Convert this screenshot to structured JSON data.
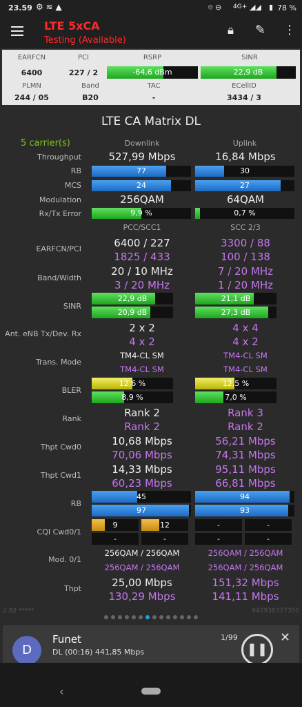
{
  "status": {
    "time": "23.59",
    "network": "4G+",
    "battery": "78 %"
  },
  "app": {
    "title": "LTE 5xCA",
    "subtitle": "Testing (Available)"
  },
  "hdr": {
    "l": {
      "earfcn": "EARFCN",
      "pci": "PCI",
      "rsrp": "RSRP",
      "sinr": "SINR",
      "plmn": "PLMN",
      "band": "Band",
      "tac": "TAC",
      "ecell": "ECellID"
    },
    "v": {
      "earfcn": "6400",
      "pci": "227 / 2",
      "rsrp": "-64,6 dBm",
      "sinr": "22,9 dB",
      "plmn": "244 / 05",
      "band": "B20",
      "tac": "-",
      "ecell": "3434 / 3"
    },
    "rsrp_fill": 0.62,
    "sinr_fill": 0.8
  },
  "matrix": {
    "title": "LTE CA Matrix DL",
    "carriers": "5 carrier(s)",
    "downlink": "Downlink",
    "uplink": "Uplink",
    "l": {
      "throughput": "Throughput",
      "rb": "RB",
      "mcs": "MCS",
      "modulation": "Modulation",
      "rxtx": "Rx/Tx Error",
      "earfcn": "EARFCN/PCI",
      "band": "Band/Width",
      "sinr": "SINR",
      "ant": "Ant. eNB Tx/Dev. Rx",
      "tm": "Trans. Mode",
      "bler": "BLER",
      "rank": "Rank",
      "cwd0": "Thpt Cwd0",
      "cwd1": "Thpt Cwd1",
      "rb2": "RB",
      "cqi": "CQI Cwd0/1",
      "mod": "Mod. 0/1",
      "thpt": "Thpt"
    },
    "dl": {
      "throughput": "527,99 Mbps",
      "rb": "77",
      "rb_fill": 0.75,
      "mcs": "24",
      "mcs_fill": 0.8,
      "mod": "256QAM",
      "err": "9,9 %",
      "err_fill": 0.5
    },
    "ul": {
      "throughput": "16,84 Mbps",
      "rb": "30",
      "rb_fill": 0.29,
      "mcs": "27",
      "mcs_fill": 0.86,
      "mod": "64QAM",
      "err": "0,7 %",
      "err_fill": 0.05
    },
    "c1": {
      "head": "PCC/SCC1",
      "earfcn_a": "6400 / 227",
      "earfcn_b": "1825 / 433",
      "band_a": "20 / 10 MHz",
      "band_b": "3 / 20 MHz",
      "sinr_a": "22,9 dB",
      "sinr_b": "20,9 dB",
      "ant_a": "2 x 2",
      "ant_b": "4 x 2",
      "tm_a": "TM4-CL SM",
      "tm_b": "TM4-CL SM",
      "bler_a": "12,6 %",
      "bler_b": "8,9 %",
      "rank_a": "Rank 2",
      "rank_b": "Rank 2",
      "cwd0_a": "10,68 Mbps",
      "cwd0_b": "70,06 Mbps",
      "cwd1_a": "14,33 Mbps",
      "cwd1_b": "60,23 Mbps",
      "rb_a": "45",
      "rb_b": "97",
      "cqi_a": "9",
      "cqi_b": "12",
      "cqi_c": "-",
      "cqi_d": "-",
      "mod_a": "256QAM / 256QAM",
      "mod_b": "256QAM / 256QAM",
      "thpt_a": "25,00 Mbps",
      "thpt_b": "130,29 Mbps"
    },
    "c2": {
      "head": "SCC 2/3",
      "earfcn_a": "3300 / 88",
      "earfcn_b": "100 / 138",
      "band_a": "7 / 20 MHz",
      "band_b": "1 / 20 MHz",
      "sinr_a": "21,1 dB",
      "sinr_b": "27,3 dB",
      "ant_a": "4 x 4",
      "ant_b": "4 x 2",
      "tm_a": "TM4-CL SM",
      "tm_b": "TM4-CL SM",
      "bler_a": "12,5 %",
      "bler_b": "7,0 %",
      "rank_a": "Rank 3",
      "rank_b": "Rank 2",
      "cwd0_a": "56,21 Mbps",
      "cwd0_b": "74,31 Mbps",
      "cwd1_a": "95,11 Mbps",
      "cwd1_b": "66,81 Mbps",
      "rb_a": "94",
      "rb_b": "93",
      "cqi_a": "-",
      "cqi_b": "-",
      "cqi_c": "-",
      "cqi_d": "-",
      "mod_a": "256QAM / 256QAM",
      "mod_b": "256QAM / 256QAM",
      "thpt_a": "151,32 Mbps",
      "thpt_b": "141,11 Mbps"
    },
    "fills": {
      "c1_sinr_a": 0.78,
      "c1_sinr_b": 0.72,
      "c2_sinr_a": 0.72,
      "c2_sinr_b": 0.9,
      "c1_bler_a": 0.5,
      "c1_bler_b": 0.4,
      "c2_bler_a": 0.48,
      "c2_bler_b": 0.35,
      "c1_rb_a": 0.46,
      "c1_rb_b": 0.98,
      "c2_rb_a": 0.95,
      "c2_rb_b": 0.94
    }
  },
  "footer": {
    "left": "2.82 *****",
    "right": "947938377350"
  },
  "pager": {
    "count": 14,
    "active": 6
  },
  "player": {
    "avatar": "D",
    "name": "Funet",
    "detail": "DL (00:16) 441,85 Mbps",
    "count": "1/99"
  }
}
